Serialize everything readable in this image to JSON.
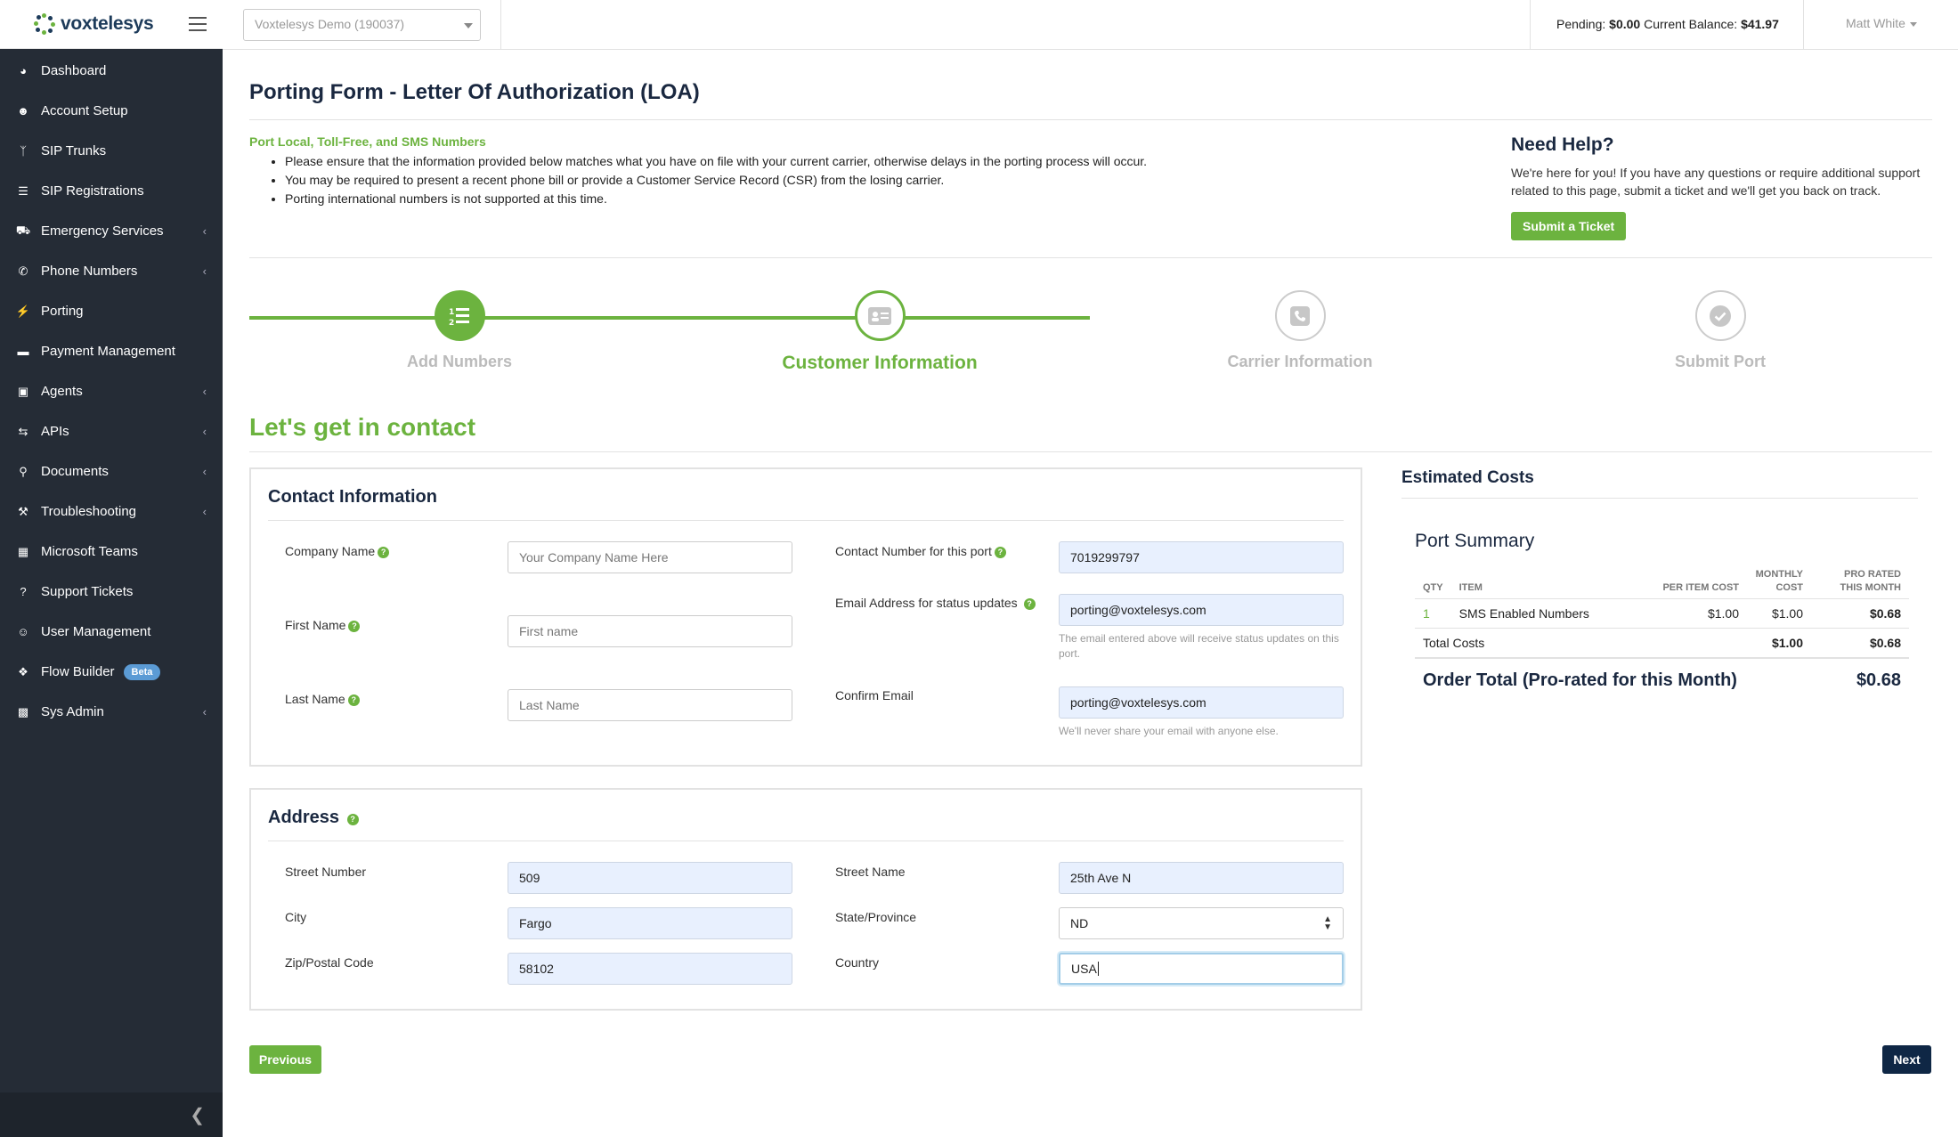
{
  "brand": {
    "name": "voxtelesys",
    "accent": "#6cb33f",
    "navy": "#1a2840",
    "sidebar_bg": "#252c36"
  },
  "sidebar": {
    "items": [
      {
        "label": "Dashboard",
        "icon": "dashboard-icon",
        "chevron": false
      },
      {
        "label": "Account Setup",
        "icon": "user-circle-icon",
        "chevron": false
      },
      {
        "label": "SIP Trunks",
        "icon": "branch-icon",
        "chevron": false
      },
      {
        "label": "SIP Registrations",
        "icon": "list-icon",
        "chevron": false
      },
      {
        "label": "Emergency Services",
        "icon": "ambulance-icon",
        "chevron": true
      },
      {
        "label": "Phone Numbers",
        "icon": "phone-icon",
        "chevron": true
      },
      {
        "label": "Porting",
        "icon": "plug-icon",
        "chevron": false
      },
      {
        "label": "Payment Management",
        "icon": "credit-card-icon",
        "chevron": false
      },
      {
        "label": "Agents",
        "icon": "briefcase-icon",
        "chevron": true
      },
      {
        "label": "APIs",
        "icon": "exchange-icon",
        "chevron": true
      },
      {
        "label": "Documents",
        "icon": "search-icon",
        "chevron": true
      },
      {
        "label": "Troubleshooting",
        "icon": "wrench-icon",
        "chevron": true
      },
      {
        "label": "Microsoft Teams",
        "icon": "windows-icon",
        "chevron": false
      },
      {
        "label": "Support Tickets",
        "icon": "question-icon",
        "chevron": false
      },
      {
        "label": "User Management",
        "icon": "users-icon",
        "chevron": false
      },
      {
        "label": "Flow Builder",
        "icon": "flow-icon",
        "chevron": false,
        "badge": "Beta"
      },
      {
        "label": "Sys Admin",
        "icon": "lock-icon",
        "chevron": true
      }
    ],
    "collapse_icon": "chevron-left-icon"
  },
  "topbar": {
    "account_select": "Voxtelesys Demo (190037)",
    "pending_label": "Pending:",
    "pending_value": "$0.00",
    "balance_label": "Current Balance:",
    "balance_value": "$41.97",
    "user": "Matt White"
  },
  "page": {
    "title": "Porting Form - Letter Of Authorization (LOA)",
    "intro_heading": "Port Local, Toll-Free, and SMS Numbers",
    "intro_bullets": [
      "Please ensure that the information provided below matches what you have on file with your current carrier, otherwise delays in the porting process will occur.",
      "You may be required to present a recent phone bill or provide a Customer Service Record (CSR) from the losing carrier.",
      "Porting international numbers is not supported at this time."
    ],
    "help_title": "Need Help?",
    "help_text": "We're here for you! If you have any questions or require additional support related to this page, submit a ticket and we'll get you back on track.",
    "help_button": "Submit a Ticket"
  },
  "steps": [
    {
      "label": "Add Numbers",
      "icon": "list-ol-icon",
      "state": "done"
    },
    {
      "label": "Customer Information",
      "icon": "id-card-icon",
      "state": "active"
    },
    {
      "label": "Carrier Information",
      "icon": "phone-square-icon",
      "state": "todo"
    },
    {
      "label": "Submit Port",
      "icon": "check-circle-icon",
      "state": "todo"
    }
  ],
  "form": {
    "heading": "Let's get in contact",
    "contact": {
      "title": "Contact Information",
      "company_label": "Company Name",
      "company_placeholder": "Your Company Name Here",
      "first_label": "First Name",
      "first_placeholder": "First name",
      "last_label": "Last Name",
      "last_placeholder": "Last Name",
      "phone_label": "Contact Number for this port",
      "phone_value": "7019299797",
      "email_label": "Email Address for status updates",
      "email_value": "porting@voxtelesys.com",
      "email_help": "The email entered above will receive status updates on this port.",
      "confirm_label": "Confirm Email",
      "confirm_value": "porting@voxtelesys.com",
      "confirm_help": "We'll never share your email with anyone else."
    },
    "address": {
      "title": "Address",
      "street_number_label": "Street Number",
      "street_number_value": "509",
      "street_name_label": "Street Name",
      "street_name_value": "25th Ave N",
      "city_label": "City",
      "city_value": "Fargo",
      "state_label": "State/Province",
      "state_value": "ND",
      "zip_label": "Zip/Postal Code",
      "zip_value": "58102",
      "country_label": "Country",
      "country_value": "USA"
    },
    "previous_button": "Previous",
    "next_button": "Next"
  },
  "costs": {
    "title": "Estimated Costs",
    "summary_title": "Port Summary",
    "headers": {
      "qty": "QTY",
      "item": "ITEM",
      "per_item": "PER ITEM COST",
      "monthly": "MONTHLY COST",
      "prorated": "PRO RATED THIS MONTH"
    },
    "rows": [
      {
        "qty": "1",
        "item": "SMS Enabled Numbers",
        "per_item": "$1.00",
        "monthly": "$1.00",
        "prorated": "$0.68"
      }
    ],
    "total_label": "Total Costs",
    "total_monthly": "$1.00",
    "total_prorated": "$0.68",
    "order_total_label": "Order Total (Pro-rated for this Month)",
    "order_total_value": "$0.68"
  }
}
